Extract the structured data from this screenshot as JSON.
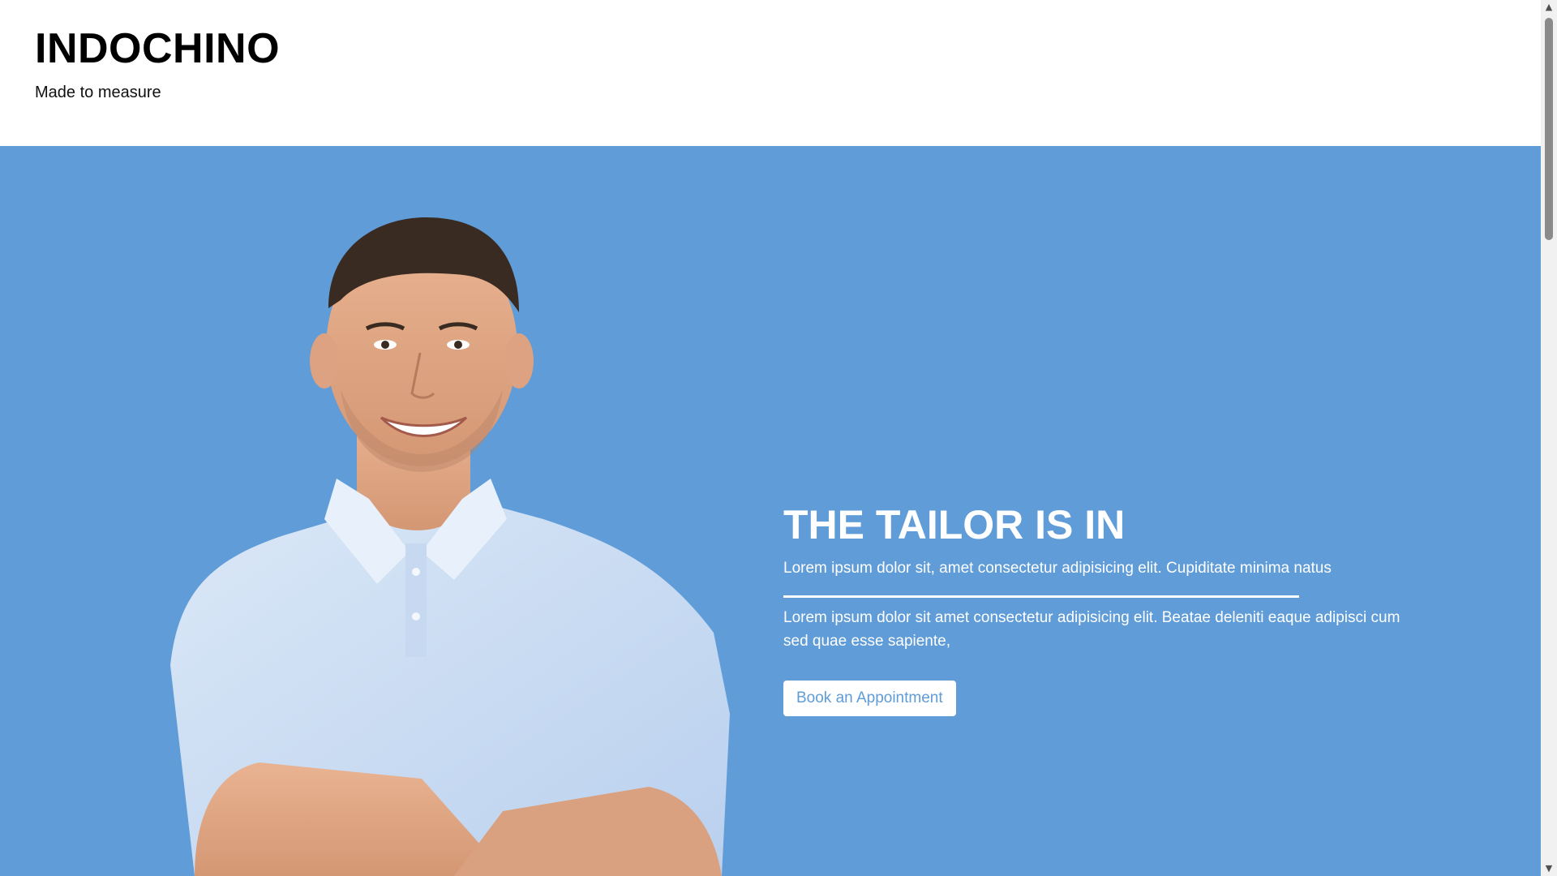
{
  "header": {
    "brand": "INDOCHINO",
    "tagline": "Made to measure"
  },
  "hero": {
    "heading": "THE TAILOR IS IN",
    "lead": "Lorem ipsum dolor sit, amet consectetur adipisicing elit. Cupiditate minima natus",
    "body": "Lorem ipsum dolor sit amet consectetur adipisicing elit. Beatae deleniti eaque adipisci cum sed quae esse sapiente,",
    "cta_label": "Book an Appointment",
    "image_name": "smiling-man-in-polo-shirt"
  },
  "colors": {
    "hero_background": "#5f9cd8",
    "button_text": "#5f9cd8",
    "header_background": "#ffffff"
  },
  "scrollbar": {
    "up_icon": "triangle-up-icon",
    "down_icon": "triangle-down-icon"
  }
}
